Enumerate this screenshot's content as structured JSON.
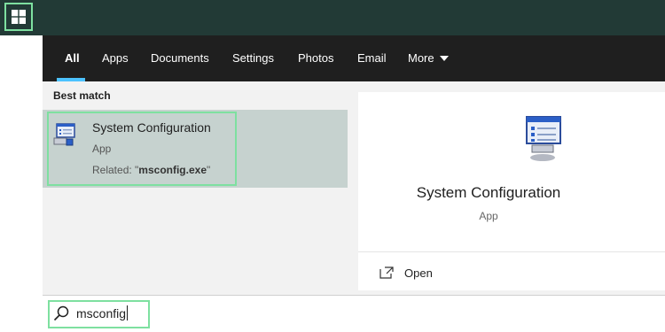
{
  "taskbar": {
    "start_icon": "windows-logo-icon"
  },
  "tabs": [
    {
      "label": "All",
      "active": true
    },
    {
      "label": "Apps",
      "active": false
    },
    {
      "label": "Documents",
      "active": false
    },
    {
      "label": "Settings",
      "active": false
    },
    {
      "label": "Photos",
      "active": false
    },
    {
      "label": "Email",
      "active": false
    },
    {
      "label": "More",
      "active": false
    }
  ],
  "results": {
    "section_label": "Best match",
    "best_match": {
      "title": "System Configuration",
      "type": "App",
      "related_prefix": "Related: \"",
      "related_name": "msconfig.exe",
      "related_suffix": "\"",
      "icon": "system-configuration-icon"
    }
  },
  "preview": {
    "title": "System Configuration",
    "type": "App",
    "actions": [
      {
        "label": "Open",
        "icon": "open-window-icon"
      }
    ]
  },
  "search": {
    "value": "msconfig",
    "icon": "search-icon"
  },
  "colors": {
    "taskbar": "#223a36",
    "navbar": "#1f1f1f",
    "highlight_frame": "#7ee0a0",
    "selected_result": "#c6d2cf",
    "panel": "#f2f2f2",
    "tab_underline": "#4cc2ff"
  }
}
